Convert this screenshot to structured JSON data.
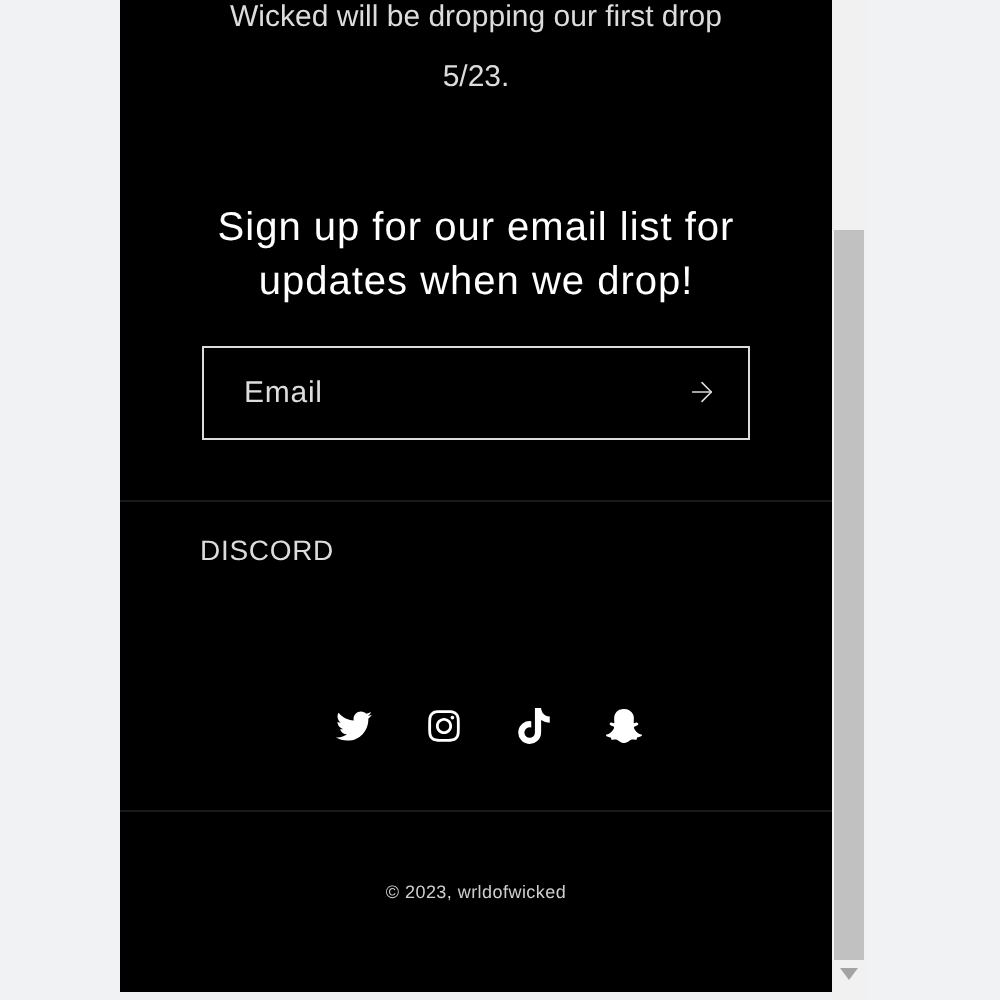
{
  "announcement": "Wicked will be dropping our first drop 5/23.",
  "signup": {
    "heading": "Sign up for our email list for updates when we drop!",
    "email_field": {
      "placeholder": "Email"
    }
  },
  "footer_links": [
    "DISCORD"
  ],
  "copyright": "© 2023, wrldofwicked"
}
